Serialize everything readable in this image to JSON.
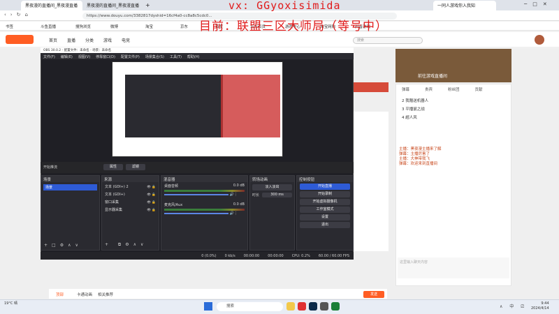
{
  "overlay": {
    "line1": "vx: GGyoxisimida",
    "line2": "目前：联盟三区大师局（等号中）"
  },
  "browser": {
    "tabs": [
      {
        "label": "黑夜漫的直播间_黑夜漫直播"
      },
      {
        "label": "黑夜漫的直播间_黑夜漫直播"
      }
    ],
    "tab_right": "一同人游戏你入我知",
    "url": "https://www.douyu.com/3382817dyshid=16cf4a0-cc8a8c5cdc0...",
    "bookmarks": [
      "书签",
      "斗鱼直播",
      "搜狗浏览",
      "微博",
      "淘宝",
      "京东",
      "百度",
      "京东百货",
      "游戏中心",
      "淘宝网购",
      "抖音游戏"
    ]
  },
  "douyu": {
    "nav": [
      "首页",
      "直播",
      "分类",
      "游戏",
      "电竞"
    ],
    "search_placeholder": "搜索",
    "room_title": "前往游戏直播间",
    "tabs": [
      "弹幕",
      "贵宾",
      "粉丝团",
      "贡献"
    ],
    "list_items": [
      "2 我赠送机器人",
      "3 平播鼠之战",
      "4 超人风"
    ],
    "chat_lines": [
      "主播：黑夜漫主播来了解",
      "弹幕：主播厉害了",
      "主播：大神带我飞",
      "弹幕：欢迎来到直播间"
    ],
    "bottom_links": [
      "顶部",
      "卡通动画",
      "相关推荐"
    ],
    "input_placeholder": "这里输入聊天内容",
    "send_label": "发送"
  },
  "obs": {
    "title": "OBS 30.0.2 - 配置文件：未命名 - 场景：未命名",
    "menu": [
      "文件(F)",
      "编辑(E)",
      "视图(V)",
      "停靠窗口(D)",
      "配置文件(P)",
      "场景集合(S)",
      "工具(T)",
      "帮助(H)"
    ],
    "source_bar": {
      "label": "开始推流",
      "props": "属性",
      "filters": "滤镜"
    },
    "scenes": {
      "title": "场景",
      "items": [
        "场景"
      ]
    },
    "sources": {
      "title": "来源",
      "items": [
        "文本 (GDI+) 2",
        "文本 (GDI+)",
        "窗口采集",
        "显示器采集"
      ]
    },
    "mixer": {
      "title": "混音器",
      "channels": [
        {
          "name": "桌面音频",
          "db": "0.0 dB"
        },
        {
          "name": "麦克风/Aux",
          "db": "0.0 dB"
        }
      ]
    },
    "transitions": {
      "title": "转场动画",
      "type": "淡入淡出",
      "duration_label": "时长",
      "duration": "300 ms"
    },
    "controls": {
      "title": "控制按钮",
      "buttons": [
        "开始直播",
        "开始录制",
        "开始虚拟摄像机",
        "工作室模式",
        "设置",
        "退出"
      ]
    },
    "status": {
      "dropped": "0 (0.0%)",
      "bitrate": "0 kb/s",
      "rec_time": "00:00:00",
      "stream_time": "00:00:00",
      "cpu": "CPU: 0.2%",
      "fps": "60.00 / 60.00 FPS"
    }
  },
  "taskbar": {
    "weather": "19°C 晴",
    "search": "搜索",
    "time": "9:44",
    "date": "2024/4/14"
  },
  "colors": {
    "accent": "#e01919",
    "douyu_orange": "#ff5d23",
    "obs_bg": "#1f1f25",
    "obs_blue": "#2e5bd6"
  }
}
